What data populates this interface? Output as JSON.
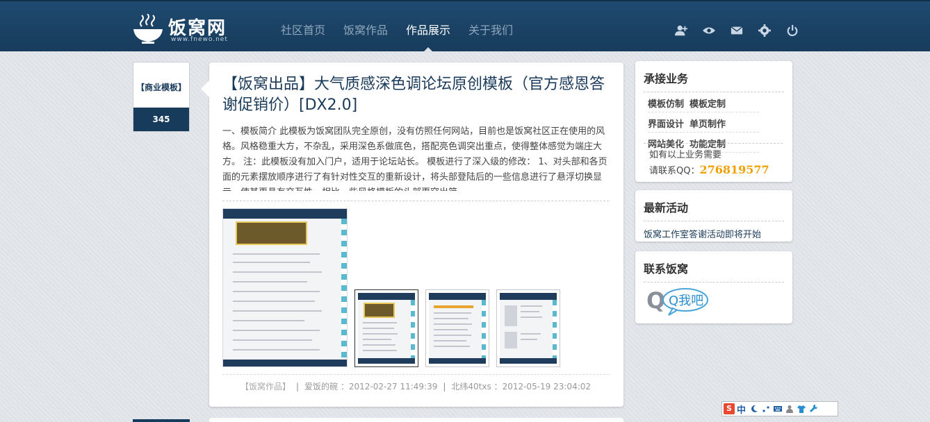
{
  "header": {
    "logo_text": "饭窝网",
    "logo_url": "www.fnewo.net",
    "nav": [
      {
        "label": "社区首页",
        "active": false
      },
      {
        "label": "饭窝作品",
        "active": false
      },
      {
        "label": "作品展示",
        "active": true
      },
      {
        "label": "关于我们",
        "active": false
      }
    ],
    "tools": [
      "add-user-icon",
      "eye-icon",
      "mail-icon",
      "gear-icon",
      "power-icon"
    ]
  },
  "tagbox": {
    "label": "【商业模板】",
    "count": "345"
  },
  "post": {
    "title": "【饭窝出品】大气质感深色调论坛原创模板（官方感恩答谢促销价）[DX2.0]",
    "summary": "一、模板简介 此模板为饭窝团队完全原创，没有仿照任何网站，目前也是饭窝社区正在使用的风格。风格稳重大方，不杂乱，采用深色系做底色，搭配亮色调突出重点，使得整体感觉为端庄大方。 注：此模板没有加入门户，适用于论坛站长。 模板进行了深入级的修改： 1、对头部和各页面的元素摆放顺序进行了有针对性交互的重新设计，将头部登陆后的一些信息进行了悬浮切换显示，使其更具有交互性。相比一些风格模板的头部更突出简",
    "meta": {
      "category": "【饭窝作品】",
      "author": "爱饭的碗",
      "posted": "2012-02-27 11:49:39",
      "last_user": "北纬40txs",
      "last_time": "2012-05-19 23:04:02"
    }
  },
  "sidebar": {
    "business": {
      "title": "承接业务",
      "rows": [
        [
          "模板仿制",
          "模板定制"
        ],
        [
          "界面设计",
          "单页制作"
        ],
        [
          "网站美化",
          "功能定制"
        ]
      ],
      "note": "如有以上业务需要",
      "qq_label": "请联系QQ：",
      "qq_number": "276819577"
    },
    "activity": {
      "title": "最新活动",
      "link": "饭窝工作室答谢活动即将开始"
    },
    "contact": {
      "title": "联系饭窝",
      "badge_text": "Q我吧"
    }
  },
  "ime": {
    "s": "S",
    "lang": "中"
  },
  "colors": {
    "header": "#173b5b",
    "accent": "#f0a000",
    "stripe": "#5bb9cf"
  }
}
